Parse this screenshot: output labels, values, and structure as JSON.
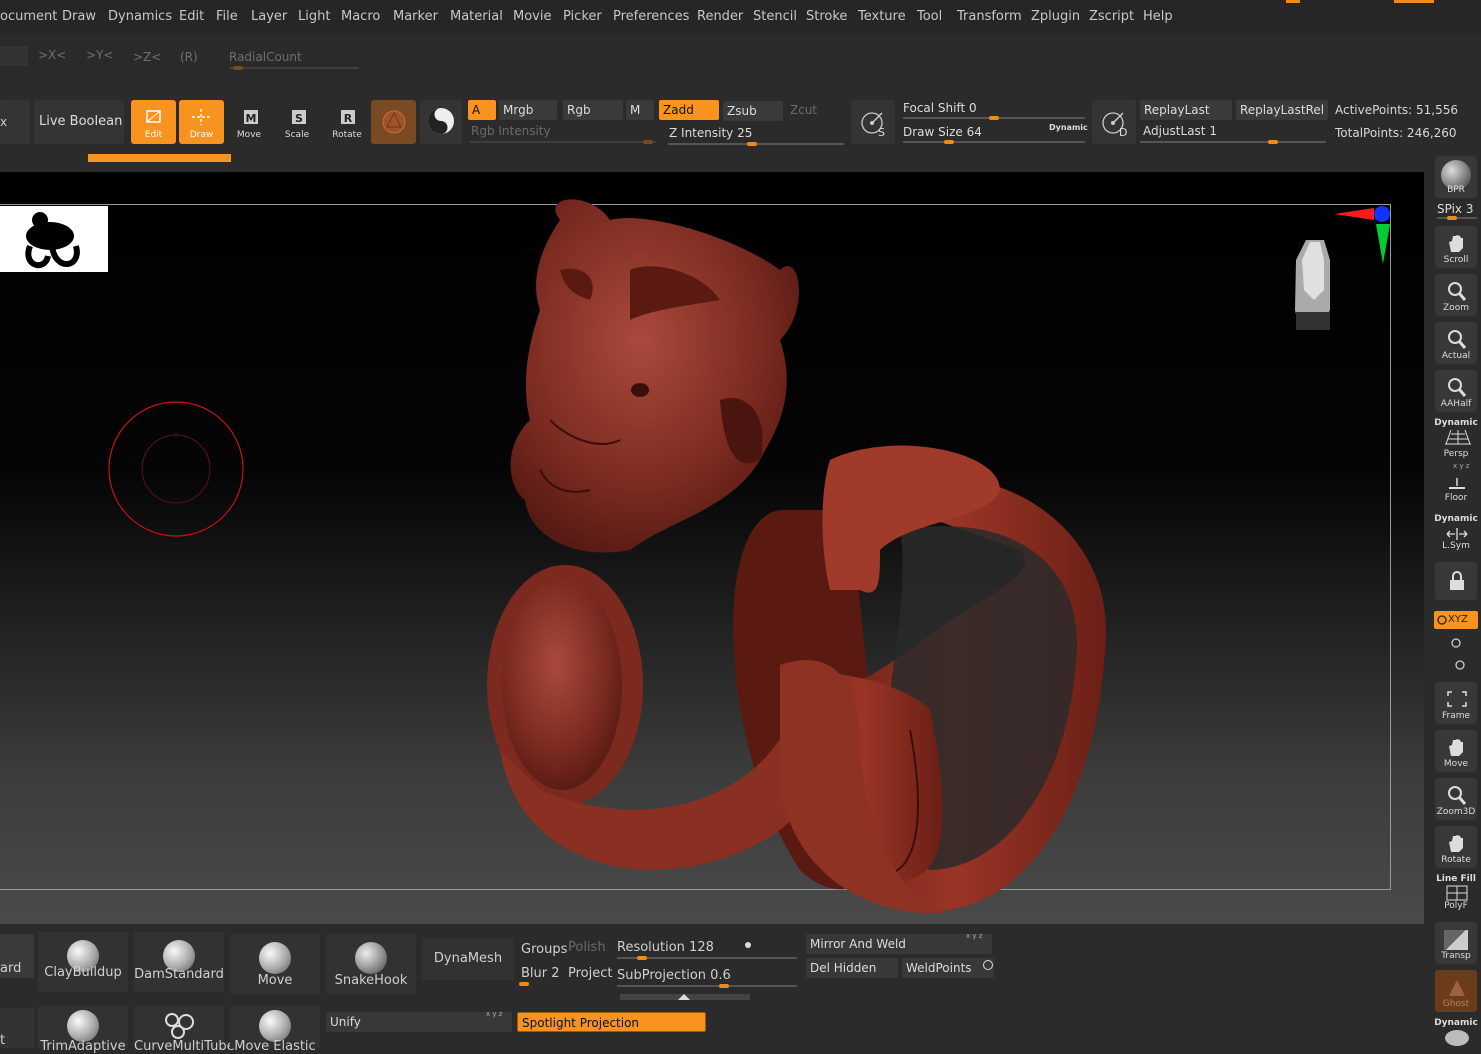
{
  "menu": [
    "ocument",
    "Draw",
    "Dynamics",
    "Edit",
    "File",
    "Layer",
    "Light",
    "Macro",
    "Marker",
    "Material",
    "Movie",
    "Picker",
    "Preferences",
    "Render",
    "Stencil",
    "Stroke",
    "Texture",
    "Tool",
    "Transform",
    "Zplugin",
    "Zscript",
    "Help"
  ],
  "symmetry": {
    "x": ">X<",
    "y": ">Y<",
    "z": ">Z<",
    "r": "(R)",
    "radial": "RadialCount"
  },
  "toolbar": {
    "clipped_label": "x",
    "live_boolean": "Live Boolean",
    "edit": "Edit",
    "draw": "Draw",
    "move": "Move",
    "scale": "Scale",
    "rotate": "Rotate",
    "a": "A",
    "mrgb": "Mrgb",
    "rgb": "Rgb",
    "m": "M",
    "zadd": "Zadd",
    "zsub": "Zsub",
    "zcut": "Zcut",
    "rgb_intensity": "Rgb Intensity",
    "z_intensity": "Z Intensity 25",
    "focal_shift": "Focal Shift 0",
    "draw_size": "Draw Size 64",
    "dynamic": "Dynamic",
    "s_letter": "S",
    "d_letter": "D",
    "replay_last": "ReplayLast",
    "replay_last_rel": "ReplayLastRel",
    "adjust_last": "AdjustLast 1",
    "active_points": "ActivePoints: 51,556",
    "total_points": "TotalPoints: 246,260"
  },
  "right_shelf": {
    "bpr": "BPR",
    "spix": "SPix 3",
    "scroll": "Scroll",
    "zoom": "Zoom",
    "actual": "Actual",
    "aahalf": "AAHalf",
    "dynamic": "Dynamic",
    "persp": "Persp",
    "floor": "Floor",
    "floor_axes": "x y z",
    "lsym": "L.Sym",
    "xyz": "XYZ",
    "frame": "Frame",
    "move": "Move",
    "zoom3d": "Zoom3D",
    "rotate": "Rotate",
    "line_fill": "Line Fill",
    "polyf": "PolyF",
    "transp": "Transp",
    "ghost": "Ghost"
  },
  "brushes": {
    "row1": [
      "ard",
      "ClayBuildup",
      "DamStandard",
      "Move",
      "SnakeHook"
    ],
    "row2": [
      "t",
      "TrimAdaptive",
      "CurveMultiTube",
      "Move Elastic"
    ]
  },
  "bottom": {
    "dynamesh": "DynaMesh",
    "groups": "Groups",
    "polish": "Polish",
    "resolution": "Resolution 128",
    "blur": "Blur 2",
    "project": "Project",
    "subprojection": "SubProjection 0.6",
    "mirror_weld": "Mirror And Weld",
    "mirror_axes": "x y z",
    "del_hidden": "Del Hidden",
    "weld_points": "WeldPoints",
    "unify": "Unify",
    "unify_axes": "x y z",
    "spotlight": "Spotlight Projection"
  },
  "colors": {
    "accent": "#f7931e",
    "model": "#8a2a1e",
    "axis_x": "#ff1a1a",
    "axis_y": "#00cc33",
    "axis_z": "#1133ff"
  }
}
